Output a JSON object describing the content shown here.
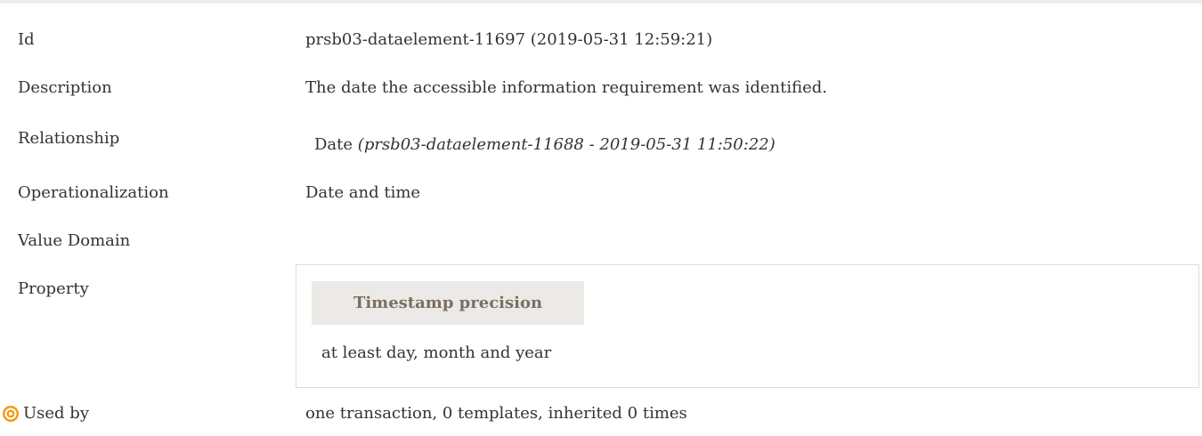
{
  "rows": {
    "id": {
      "label": "Id",
      "value": "prsb03-dataelement-11697 (2019-05-31 12:59:21)"
    },
    "description": {
      "label": "Description",
      "value": "The date the accessible information requirement was identified."
    },
    "relationship": {
      "label": "Relationship",
      "value_name": "Date",
      "value_target": "(prsb03-dataelement-11688 - 2019-05-31 11:50:22)"
    },
    "operationalization": {
      "label": "Operationalization",
      "value": "Date and time"
    },
    "value_domain": {
      "label": "Value Domain",
      "value": ""
    },
    "property": {
      "label": "Property",
      "header": "Timestamp precision",
      "value": "at least day, month and year"
    },
    "used_by": {
      "label": "Used by",
      "value": "one transaction, 0 templates, inherited 0 times",
      "icon": "target-icon"
    }
  },
  "colors": {
    "icon_orange": "#f39c12",
    "property_header_bg": "#eceae6",
    "property_header_text": "#7a6f63"
  }
}
